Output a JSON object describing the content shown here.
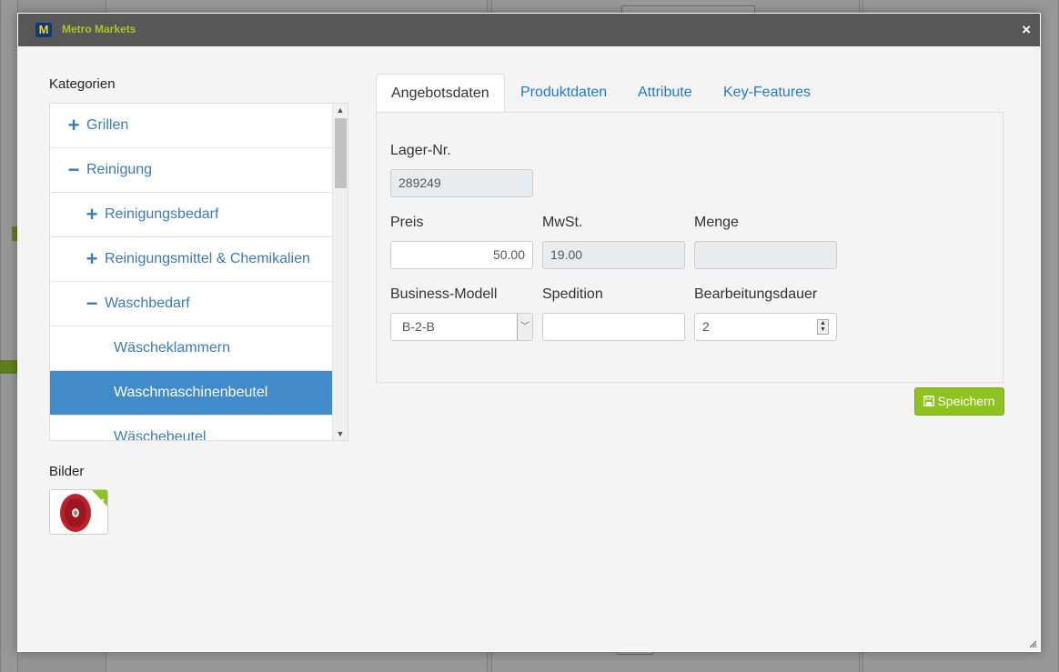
{
  "dialog": {
    "logo_letter": "M",
    "title": "Metro Markets",
    "close_label": "×"
  },
  "categories": {
    "heading": "Kategorien",
    "items": [
      {
        "label": "Grillen",
        "sign": "+",
        "level": 0,
        "selected": false
      },
      {
        "label": "Reinigung",
        "sign": "−",
        "level": 0,
        "selected": false
      },
      {
        "label": "Reinigungsbedarf",
        "sign": "+",
        "level": 1,
        "selected": false
      },
      {
        "label": "Reinigungsmittel & Chemikalien",
        "sign": "+",
        "level": 1,
        "selected": false
      },
      {
        "label": "Waschbedarf",
        "sign": "−",
        "level": 1,
        "selected": false
      },
      {
        "label": "Wäscheklammern",
        "sign": "",
        "level": 2,
        "selected": false
      },
      {
        "label": "Waschmaschinenbeutel",
        "sign": "",
        "level": 2,
        "selected": true
      },
      {
        "label": "Wäschebeutel",
        "sign": "",
        "level": 2,
        "selected": false
      }
    ]
  },
  "images": {
    "heading": "Bilder"
  },
  "tabs": [
    {
      "label": "Angebotsdaten",
      "active": true
    },
    {
      "label": "Produktdaten",
      "active": false
    },
    {
      "label": "Attribute",
      "active": false
    },
    {
      "label": "Key-Features",
      "active": false
    }
  ],
  "form": {
    "lager_label": "Lager-Nr.",
    "lager_value": "289249",
    "preis_label": "Preis",
    "preis_value": "50.00",
    "mwst_label": "MwSt.",
    "mwst_value": "19.00",
    "menge_label": "Menge",
    "menge_value": "",
    "business_label": "Business-Modell",
    "business_value": "B-2-B",
    "spedition_label": "Spedition",
    "spedition_value": "",
    "bearbeitung_label": "Bearbeitungsdauer",
    "bearbeitung_value": "2"
  },
  "save_label": "Speichern",
  "colors": {
    "title_accent": "#a6c822",
    "selected_row": "#428bca",
    "link_blue": "#1d7ad8",
    "save_green": "#8fc21f"
  }
}
